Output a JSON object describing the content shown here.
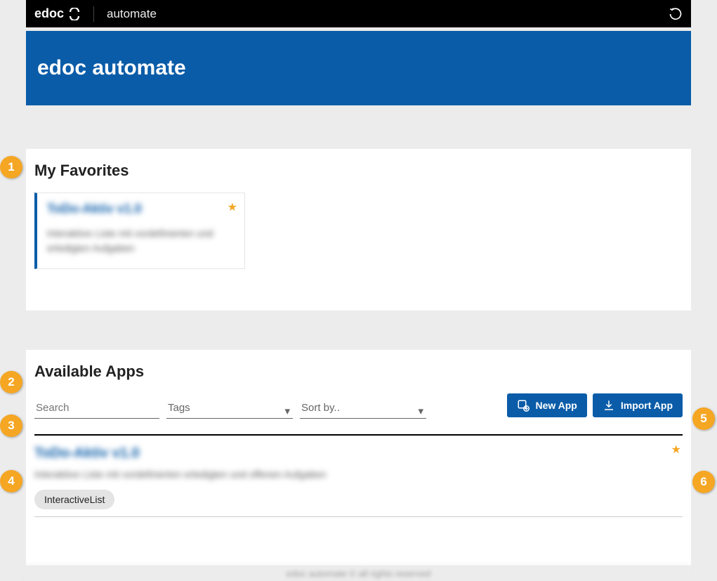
{
  "topbar": {
    "brand": "edoc",
    "module": "automate"
  },
  "hero": {
    "title": "edoc automate"
  },
  "favorites": {
    "heading": "My Favorites",
    "card": {
      "title": "ToDo-Aktiv v1.0",
      "description": "Interaktive Liste mit vordefinierten und erledigten Aufgaben"
    }
  },
  "apps": {
    "heading": "Available Apps",
    "search_placeholder": "Search",
    "tags_placeholder": "Tags",
    "sort_placeholder": "Sort by..",
    "new_app_label": "New App",
    "import_app_label": "Import App",
    "row": {
      "title": "ToDo-Aktiv v1.0",
      "description": "Interaktive Liste mit vordefinierten erledigten und offenen Aufgaben",
      "tag": "InteractiveList"
    }
  },
  "footer_text": "edoc automate © all rights reserved",
  "callouts": {
    "c1": "1",
    "c2": "2",
    "c3": "3",
    "c4": "4",
    "c5": "5",
    "c6": "6"
  }
}
